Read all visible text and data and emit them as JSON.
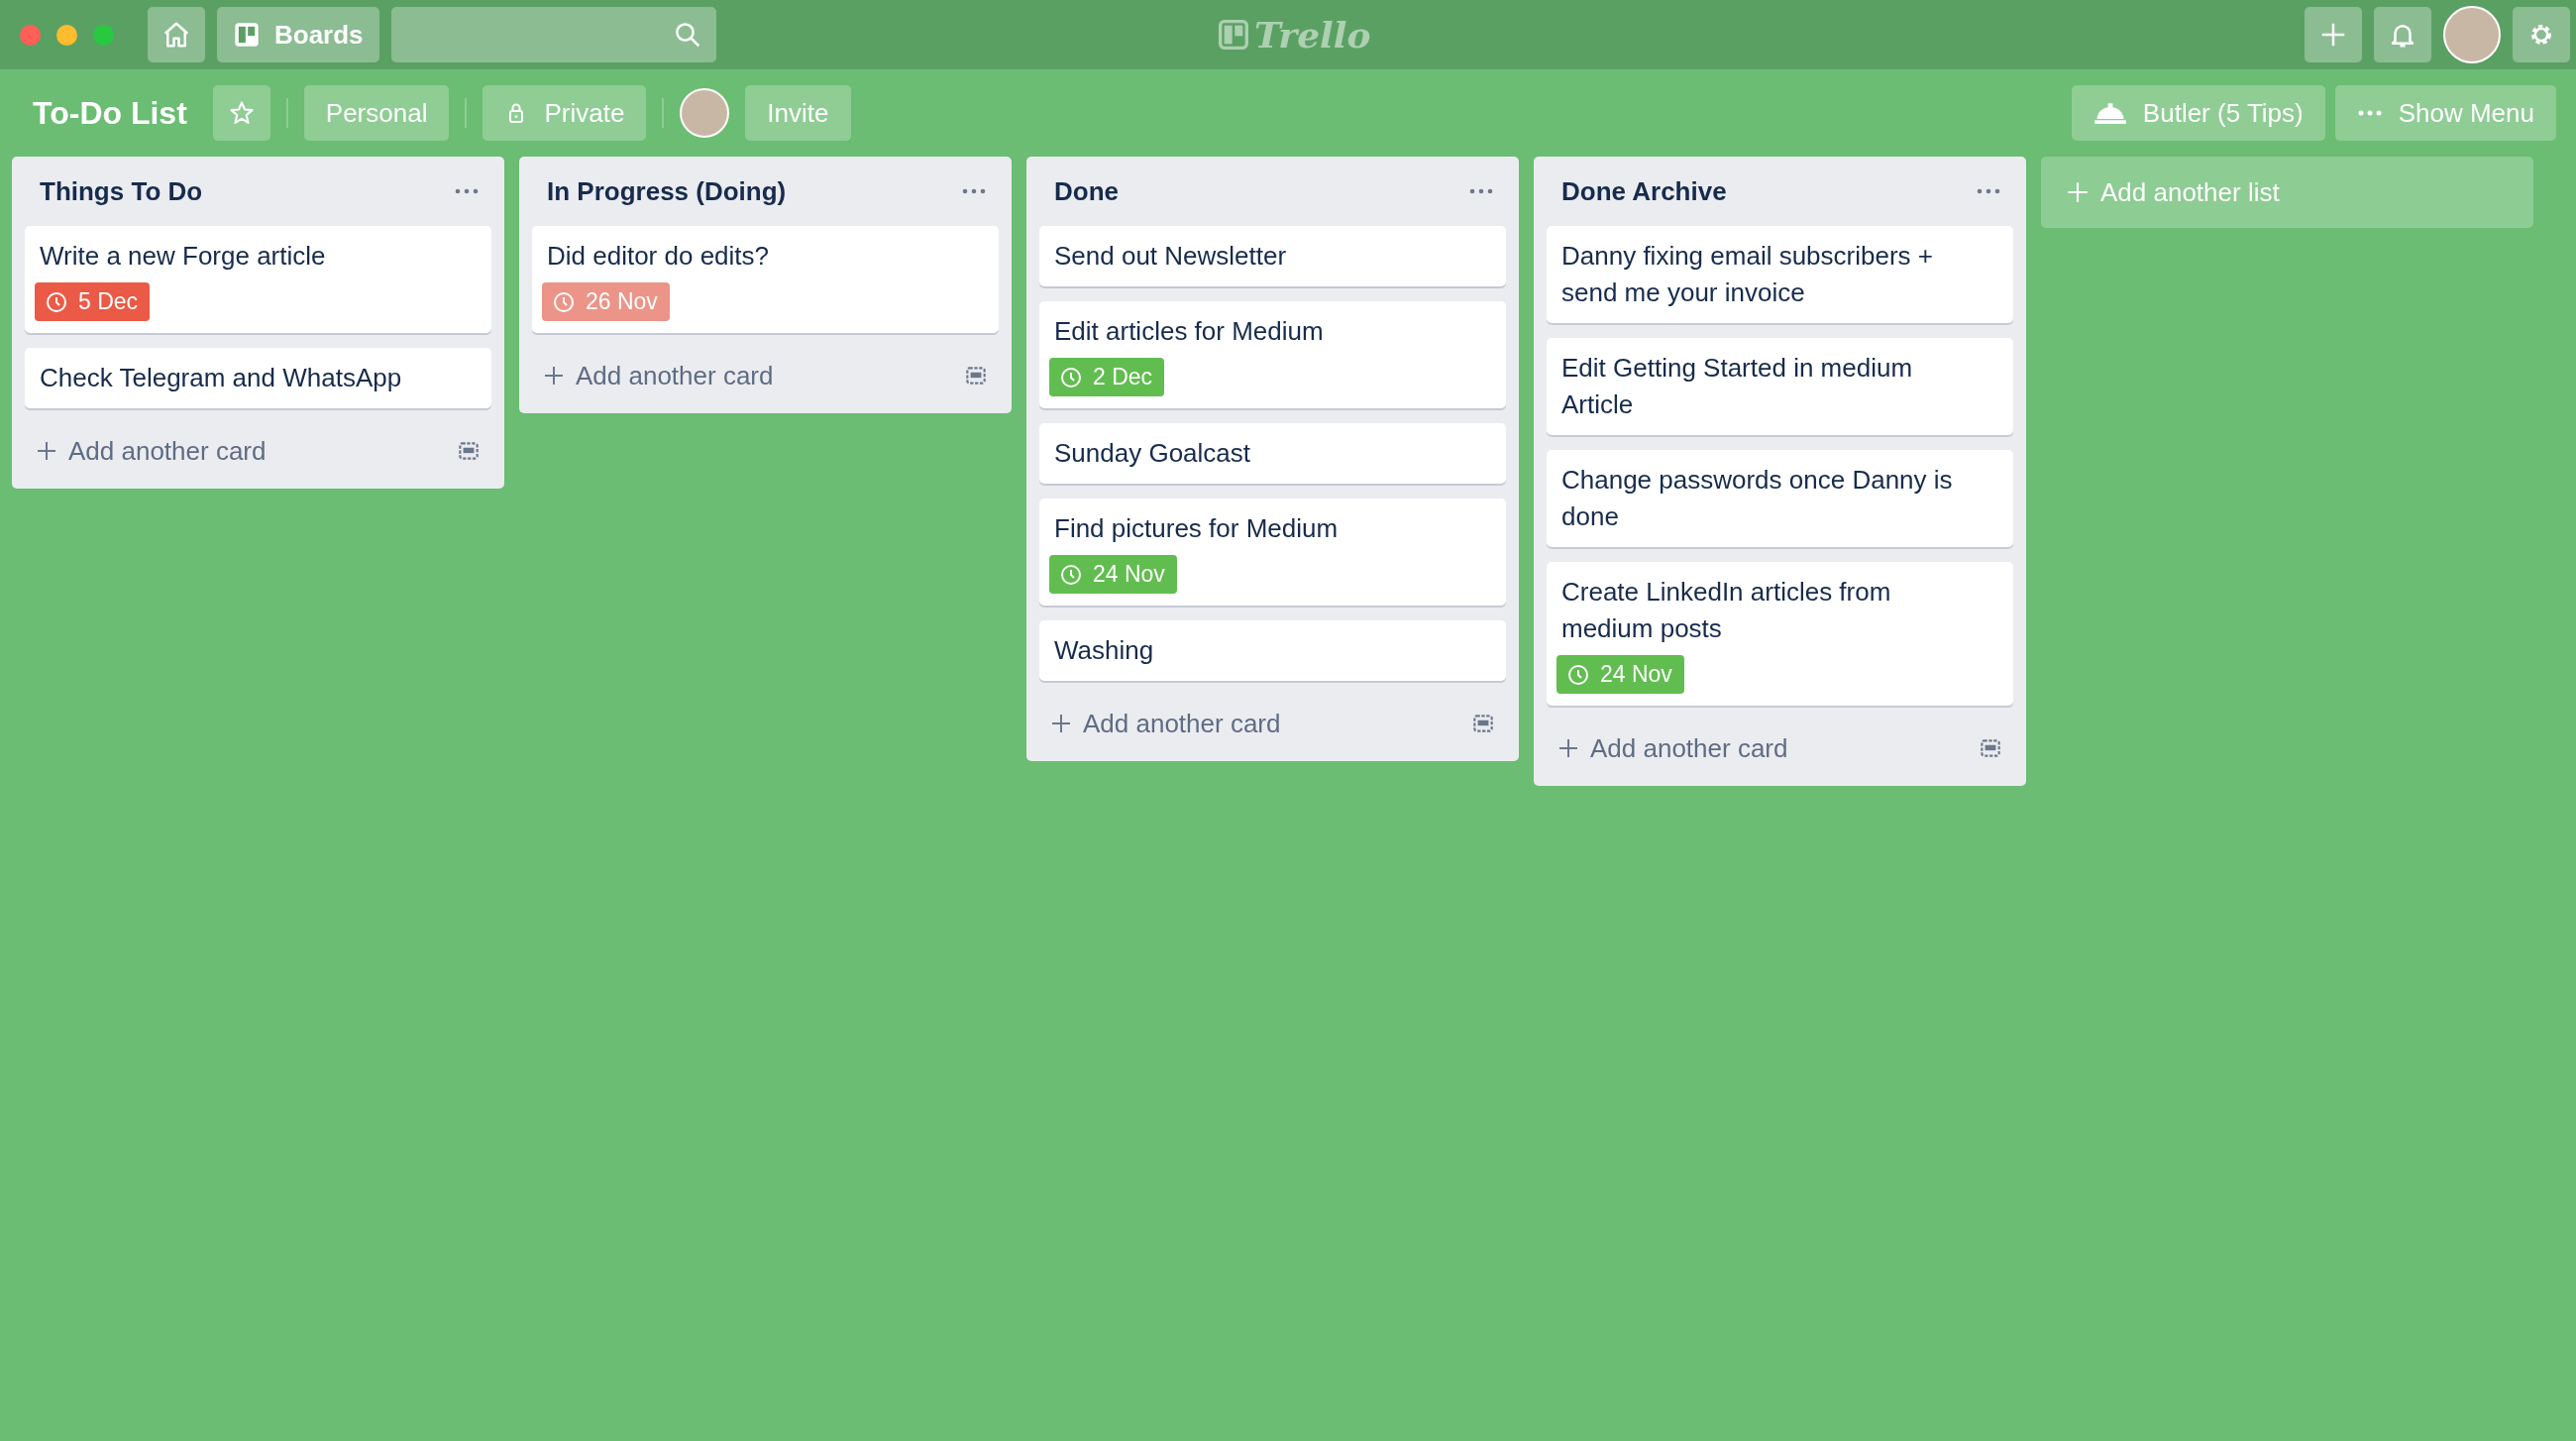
{
  "top_bar": {
    "boards_label": "Boards",
    "logo": "Trello"
  },
  "board_header": {
    "title": "To-Do List",
    "starred": false,
    "team": "Personal",
    "visibility": "Private",
    "invite": "Invite",
    "butler": "Butler (5 Tips)",
    "menu": "Show Menu"
  },
  "lists": [
    {
      "title": "Things To Do",
      "add_card": "Add another card",
      "cards": [
        {
          "title": "Write a new Forge article",
          "due": {
            "label": "5 Dec",
            "color": "#eb5a46"
          }
        },
        {
          "title": "Check Telegram and WhatsApp"
        }
      ]
    },
    {
      "title": "In Progress (Doing)",
      "add_card": "Add another card",
      "cards": [
        {
          "title": "Did editor do edits?",
          "due": {
            "label": "26 Nov",
            "color": "#ec9488"
          }
        }
      ]
    },
    {
      "title": "Done",
      "add_card": "Add another card",
      "cards": [
        {
          "title": "Send out Newsletter"
        },
        {
          "title": "Edit articles for Medium",
          "due": {
            "label": "2 Dec",
            "color": "#61bd4f"
          }
        },
        {
          "title": "Sunday Goalcast"
        },
        {
          "title": "Find pictures for Medium",
          "due": {
            "label": "24 Nov",
            "color": "#61bd4f"
          }
        },
        {
          "title": "Washing"
        }
      ]
    },
    {
      "title": "Done Archive",
      "add_card": "Add another card",
      "cards": [
        {
          "title": "Danny fixing email subscribers + send me your invoice"
        },
        {
          "title": "Edit Getting Started in medium Article"
        },
        {
          "title": "Change passwords once Danny is done"
        },
        {
          "title": "Create LinkedIn articles from medium posts",
          "due": {
            "label": "24 Nov",
            "color": "#61bd4f"
          }
        }
      ]
    }
  ],
  "add_list": "Add another list"
}
